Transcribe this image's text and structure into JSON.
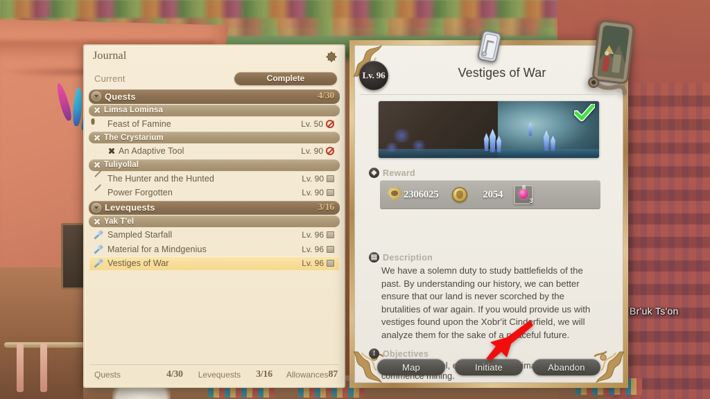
{
  "background": {
    "npc_nameplate": "Br'uk Ts'on"
  },
  "journal": {
    "title": "Journal",
    "close_icon": "close-icon",
    "tabs": {
      "current_label": "Current",
      "complete_label": "Complete"
    },
    "list": [
      {
        "kind": "category",
        "icon": "collapse-arrow-icon",
        "label": "Quests",
        "count": "4/30"
      },
      {
        "kind": "zone",
        "icon": "zone-diamond-icon",
        "label": "Limsa Lominsa"
      },
      {
        "kind": "quest",
        "icon": "quest-main-icon",
        "label": "Feast of Famine",
        "level": "Lv. 50",
        "flag": "no-drop-icon",
        "selected": false
      },
      {
        "kind": "zone",
        "icon": "zone-diamond-icon",
        "label": "The Crystarium"
      },
      {
        "kind": "quest",
        "icon": "quest-blue-icon",
        "label": "An Adaptive Tool",
        "level": "Lv. 90",
        "flag": "no-drop-icon",
        "selected": false,
        "sub_icon": "mini-diamond-icon"
      },
      {
        "kind": "zone",
        "icon": "zone-diamond-icon",
        "label": "Tuliyollal"
      },
      {
        "kind": "quest",
        "icon": "quest-gray-icon",
        "label": "The Hunter and the Hunted",
        "level": "Lv. 90",
        "flag": "book-icon",
        "selected": false
      },
      {
        "kind": "quest",
        "icon": "quest-gray-icon",
        "label": "Power Forgotten",
        "level": "Lv. 90",
        "flag": "book-icon",
        "selected": false
      },
      {
        "kind": "category",
        "icon": "collapse-arrow-icon",
        "label": "Levequests",
        "count": "3/16"
      },
      {
        "kind": "zone",
        "icon": "zone-diamond-icon",
        "label": "Yak T'el"
      },
      {
        "kind": "quest",
        "icon": "leve-icon",
        "label": "Sampled Starfall",
        "level": "Lv. 96",
        "flag": "book-icon",
        "selected": false
      },
      {
        "kind": "quest",
        "icon": "leve-icon",
        "label": "Material for a Mindgenius",
        "level": "Lv. 96",
        "flag": "book-icon",
        "selected": false
      },
      {
        "kind": "quest",
        "icon": "leve-icon",
        "label": "Vestiges of War",
        "level": "Lv. 96",
        "flag": "book-icon",
        "selected": true
      }
    ],
    "footer": {
      "quests_label": "Quests",
      "quests_value": "4/30",
      "levequests_label": "Levequests",
      "levequests_value": "3/16",
      "allowances_label": "Allowances",
      "allowances_value": "87"
    }
  },
  "detail": {
    "level_badge": "Lv. 96",
    "title": "Vestiges of War",
    "thumbnail_alt": "crystal-cave-thumbnail",
    "completed_check_icon": "green-check-icon",
    "plate_icon": "quest-plate-icon",
    "bookmark_icon": "bookmark-tablet-icon",
    "reward": {
      "section_icon": "reward-icon",
      "section_title": "Reward",
      "items": [
        {
          "icon": "exp-icon",
          "value": "2306025"
        },
        {
          "icon": "gil-icon",
          "value": "2054"
        },
        {
          "icon": "potion-item-icon",
          "value": "",
          "qty": "3"
        }
      ]
    },
    "description": {
      "section_icon": "description-icon",
      "section_title": "Description",
      "text": "We have a solemn duty to study battlefields of the past. By understanding our history, we can better ensure that our land is never scorched by the brutalities of war again. If you would provide us with vestiges found upon the Xobr'it Cinderfield, we will analyze them for the sake of a peaceful future."
    },
    "objectives": {
      "section_icon": "objectives-icon",
      "section_title": "Objectives",
      "text": "Travel to Yak T'el, equip a miner's primary tool, and commence mining."
    },
    "buttons": [
      {
        "label": "Map"
      },
      {
        "label": "Initiate"
      },
      {
        "label": "Abandon"
      }
    ]
  },
  "annotation": {
    "arrow_icon": "red-arrow-icon",
    "arrow_color": "#f01010",
    "points_to": "Initiate"
  },
  "colors": {
    "journal_bg": "#f4e9d2",
    "journal_border": "#e3d2b0",
    "category_row": "#8b7152",
    "zone_row": "#ab9775",
    "selected_row": "#f8dd9b",
    "detail_bg": "#efece4",
    "frame_gold": "#c8a76a",
    "button_dark": "#56544f",
    "accent_count": "#e0bb7e",
    "check_green": "#4ee04e"
  }
}
